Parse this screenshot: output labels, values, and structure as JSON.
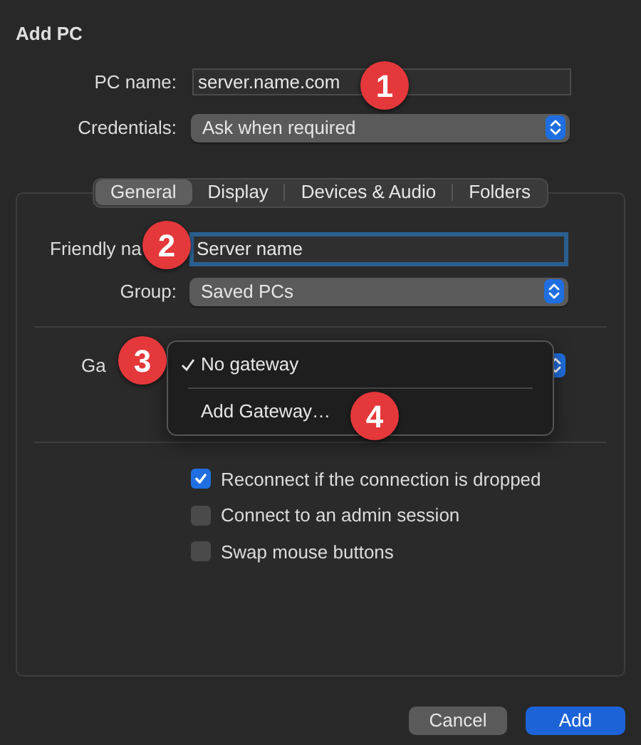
{
  "window": {
    "title": "Add PC"
  },
  "pc_name": {
    "label": "PC name:",
    "value": "server.name.com"
  },
  "credentials": {
    "label": "Credentials:",
    "value": "Ask when required"
  },
  "tabs": [
    {
      "label": "General",
      "selected": true
    },
    {
      "label": "Display",
      "selected": false
    },
    {
      "label": "Devices & Audio",
      "selected": false
    },
    {
      "label": "Folders",
      "selected": false
    }
  ],
  "friendly_name": {
    "label": "Friendly na",
    "value": "Server name",
    "focused": true
  },
  "group": {
    "label": "Group:",
    "value": "Saved PCs"
  },
  "gateway": {
    "label": "Ga",
    "menu": [
      {
        "label": "No gateway",
        "checked": true
      },
      {
        "label": "Add Gateway…",
        "checked": false
      }
    ]
  },
  "options": [
    {
      "label": "Reconnect if the connection is dropped",
      "checked": true
    },
    {
      "label": "Connect to an admin session",
      "checked": false
    },
    {
      "label": "Swap mouse buttons",
      "checked": false
    }
  ],
  "buttons": [
    {
      "label": "Cancel",
      "kind": "secondary"
    },
    {
      "label": "Add",
      "kind": "primary"
    }
  ],
  "callouts": [
    {
      "label": "1"
    },
    {
      "label": "2"
    },
    {
      "label": "3"
    },
    {
      "label": "4"
    }
  ]
}
